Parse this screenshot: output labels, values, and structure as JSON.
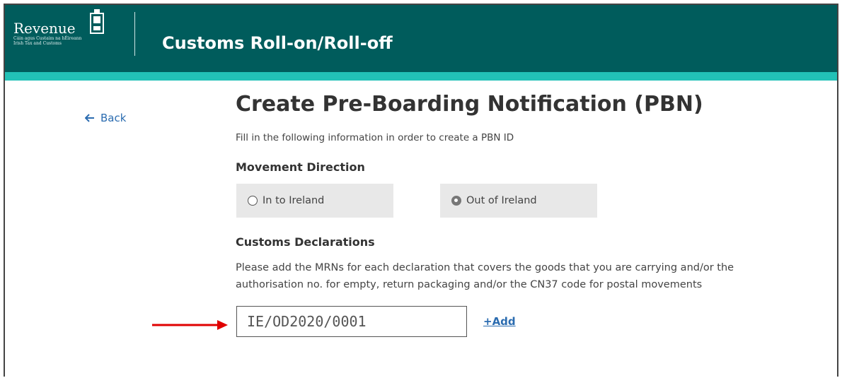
{
  "header": {
    "logo_text": "Revenue",
    "logo_subtitle_line1": "Cáin agus Custaim na hÉireann",
    "logo_subtitle_line2": "Irish Tax and Customs",
    "app_title": "Customs Roll-on/Roll-off"
  },
  "nav": {
    "back_label": "Back"
  },
  "page": {
    "title": "Create Pre-Boarding Notification (PBN)",
    "intro": "Fill in the following information in order to create a PBN ID"
  },
  "movement_direction": {
    "label": "Movement Direction",
    "options": [
      {
        "label": "In to Ireland",
        "selected": false
      },
      {
        "label": "Out of Ireland",
        "selected": true
      }
    ]
  },
  "customs_declarations": {
    "label": "Customs Declarations",
    "description": "Please add the MRNs for each declaration that covers the goods that you are carrying and/or the authorisation no. for empty, return packaging and/or the CN37 code for postal movements",
    "mrn_value": "IE/OD2020/0001",
    "add_label": "+Add"
  },
  "colors": {
    "header_bg": "#005c5c",
    "header_stripe": "#22c1b7",
    "link": "#2b6cb0",
    "arrow": "#e00000"
  }
}
